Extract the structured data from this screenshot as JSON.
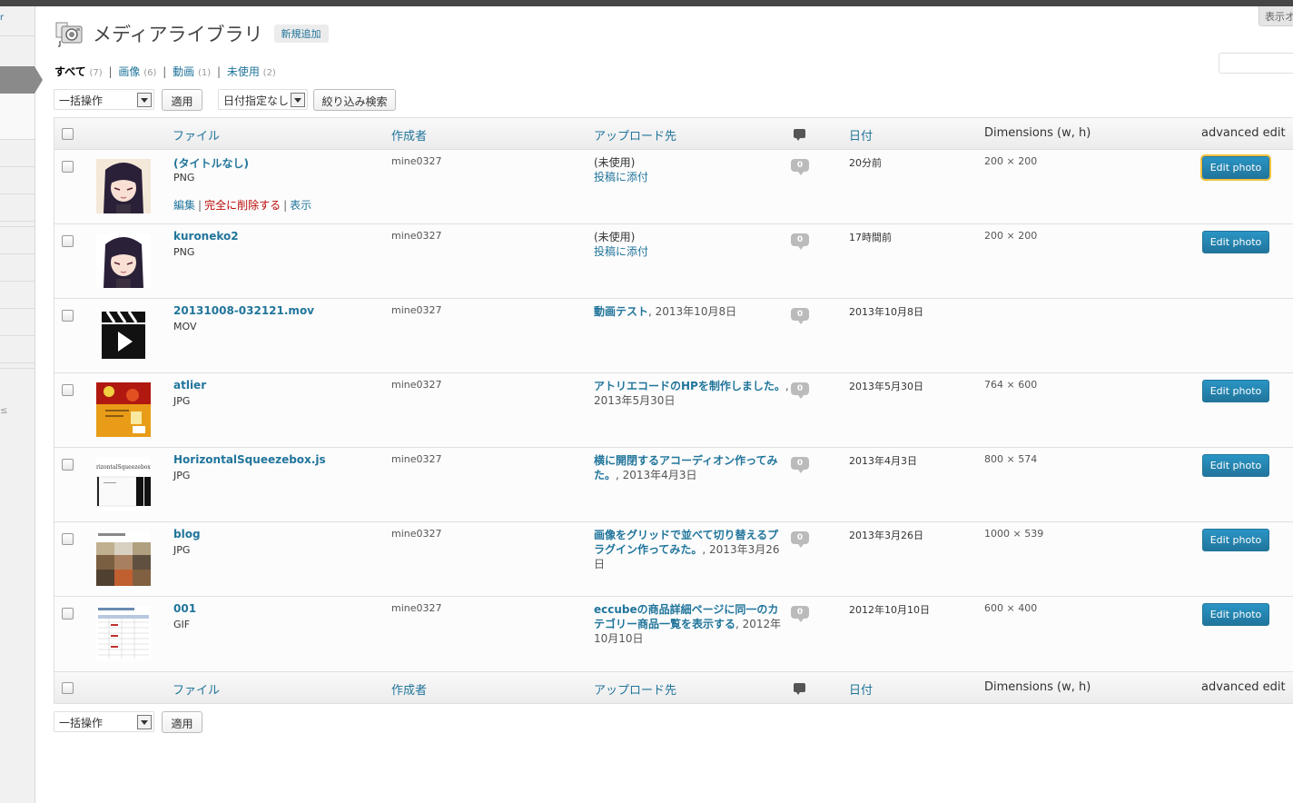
{
  "screen_options": "表示オ",
  "title": "メディアライブラリ",
  "add_new": "新規追加",
  "filters": [
    {
      "label": "すべて",
      "count": "(7)",
      "current": true
    },
    {
      "label": "画像",
      "count": "(6)"
    },
    {
      "label": "動画",
      "count": "(1)"
    },
    {
      "label": "未使用",
      "count": "(2)"
    }
  ],
  "bulk_action": "一括操作",
  "apply": "適用",
  "date_filter": "日付指定なし",
  "filter_button": "絞り込み検索",
  "columns": {
    "file": "ファイル",
    "author": "作成者",
    "uploaded_to": "アップロード先",
    "date": "日付",
    "dimensions": "Dimensions (w, h)",
    "advanced_edit": "advanced edit"
  },
  "row_actions": {
    "edit": "編集",
    "delete": "完全に削除する",
    "view": "表示"
  },
  "edit_photo_label": "Edit photo",
  "rows": [
    {
      "name": "(タイトルなし)",
      "type": "PNG",
      "author": "mine0327",
      "parent_unused": "(未使用)",
      "attach": "投稿に添付",
      "comments": "0",
      "date": "20分前",
      "dims": "200 × 200",
      "thumb": "anime-girl"
    },
    {
      "name": "kuroneko2",
      "type": "PNG",
      "author": "mine0327",
      "parent_unused": "(未使用)",
      "attach": "投稿に添付",
      "comments": "0",
      "date": "17時間前",
      "dims": "200 × 200",
      "thumb": "anime-girl"
    },
    {
      "name": "20131008-032121.mov",
      "type": "MOV",
      "author": "mine0327",
      "parent_link": "動画テスト",
      "parent_date": ", 2013年10月8日",
      "comments": "0",
      "date": "2013年10月8日",
      "dims": "",
      "thumb": "video-clapper"
    },
    {
      "name": "atlier",
      "type": "JPG",
      "author": "mine0327",
      "parent_link": "アトリエコードのHPを制作しました。",
      "parent_date": ", 2013年5月30日",
      "comments": "0",
      "date": "2013年5月30日",
      "dims": "764 × 600",
      "thumb": "website-red"
    },
    {
      "name": "HorizontalSqueezebox.js",
      "type": "JPG",
      "author": "mine0327",
      "parent_link": "横に開閉するアコーディオン作ってみた。",
      "parent_date": ", 2013年4月3日",
      "comments": "0",
      "date": "2013年4月3日",
      "dims": "800 × 574",
      "thumb": "squeezebox",
      "thumb_text": "rizontalSqueezebox"
    },
    {
      "name": "blog",
      "type": "JPG",
      "author": "mine0327",
      "parent_link": "画像をグリッドで並べて切り替えるプラグイン作ってみた。",
      "parent_date": ", 2013年3月26日",
      "comments": "0",
      "date": "2013年3月26日",
      "dims": "1000 × 539",
      "thumb": "blog-grid"
    },
    {
      "name": "001",
      "type": "GIF",
      "author": "mine0327",
      "parent_link": "eccubeの商品詳細ページに同一のカテゴリー商品一覧を表示する",
      "parent_date": ", 2012年10月10日",
      "comments": "0",
      "date": "2012年10月10日",
      "dims": "600 × 400",
      "thumb": "table-gif"
    }
  ]
}
